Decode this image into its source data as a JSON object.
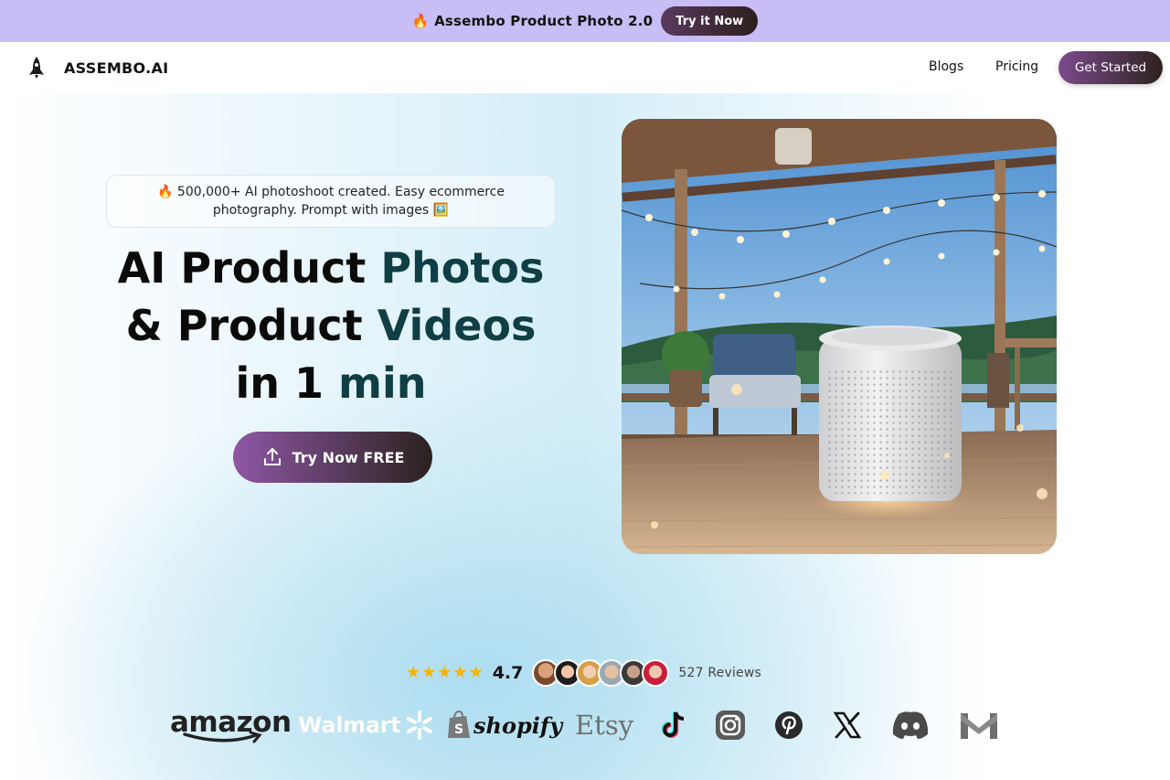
{
  "announcement": {
    "text": "🔥 Assembo Product Photo 2.0",
    "button_label": "Try it Now"
  },
  "nav": {
    "brand": "ASSEMBO.AI",
    "links": [
      {
        "label": "Blogs"
      },
      {
        "label": "Pricing"
      }
    ],
    "cta_label": "Get Started"
  },
  "hero": {
    "badge_text": "🔥 500,000+ AI photoshoot created. Easy ecommerce photography. Prompt with images 🖼️",
    "headline": {
      "line1_a": "AI Product ",
      "line1_b": "Photos",
      "line2_a": "& Product ",
      "line2_b": "Videos",
      "line3_a": "in 1 ",
      "line3_b": "min"
    },
    "cta_label": "Try Now FREE",
    "image_alt": "White cylindrical air purifier on a wooden deck with string lights"
  },
  "reviews": {
    "stars": [
      "★",
      "★",
      "★",
      "★",
      "★"
    ],
    "rating": "4.7",
    "count_text": "527 Reviews",
    "avatar_count": 6
  },
  "logos": {
    "amazon": "amazon",
    "walmart": "Walmart",
    "shopify": "shopify",
    "etsy": "Etsy",
    "icons": [
      "tiktok-icon",
      "instagram-icon",
      "pinterest-icon",
      "x-icon",
      "discord-icon",
      "gmail-icon"
    ]
  },
  "colors": {
    "announcement_bg": "#c8bdf5",
    "accent_dark_teal": "#0f3e44",
    "star": "#f5b400",
    "cta_gradient_start": "#8f57a6",
    "cta_gradient_end": "#2b221f"
  }
}
